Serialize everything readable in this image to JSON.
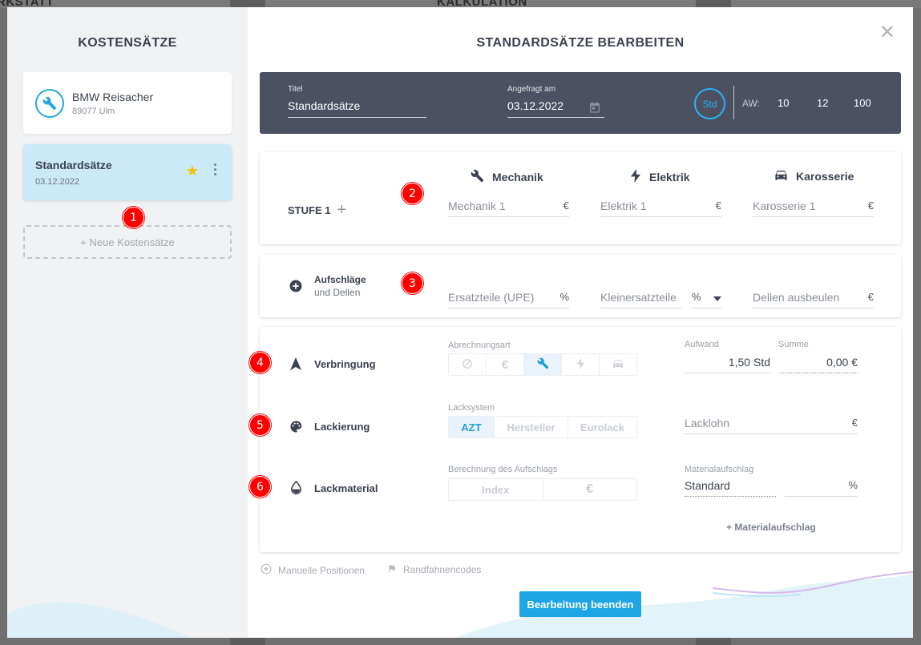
{
  "background": {
    "left_text": "RKSTATT",
    "center_text": "KALKULATION"
  },
  "sidebar": {
    "title": "KOSTENSÄTZE",
    "cards": [
      {
        "name": "BMW Reisacher",
        "sub": "89077 Ulm",
        "icon": "wrench-icon"
      },
      {
        "name": "Standardsätze",
        "sub": "03.12.2022",
        "favorite": true
      }
    ],
    "new_button": "+ Neue Kostensätze"
  },
  "main": {
    "title": "STANDARDSÄTZE BEARBEITEN",
    "header": {
      "titel_label": "Titel",
      "titel_value": "Standardsätze",
      "date_label": "Angefragt am",
      "date_value": "03.12.2022",
      "std_label": "Std",
      "aw_label": "AW:",
      "aw_values": [
        "10",
        "12",
        "100"
      ]
    },
    "rates": {
      "stufe_label": "STUFE 1",
      "columns": [
        {
          "title": "Mechanik",
          "icon": "wrench-icon",
          "placeholder": "Mechanik 1",
          "unit": "€"
        },
        {
          "title": "Elektrik",
          "icon": "bolt-icon",
          "placeholder": "Elektrik 1",
          "unit": "€"
        },
        {
          "title": "Karosserie",
          "icon": "car-icon",
          "placeholder": "Karosserie 1",
          "unit": "€"
        }
      ]
    },
    "surcharges": {
      "title": "Aufschläge",
      "subtitle": "und Dellen",
      "ersatzteile": {
        "placeholder": "Ersatzteile (UPE)",
        "unit": "%"
      },
      "kleinersatzteile": {
        "placeholder": "Kleinersatzteile",
        "unit": "%"
      },
      "dellen": {
        "placeholder": "Dellen ausbeulen",
        "unit": "€"
      }
    },
    "verbringung": {
      "label": "Verbringung",
      "abrechnungsart_label": "Abrechnungsart",
      "aufwand_label": "Aufwand",
      "aufwand_value": "1,50 Std",
      "summe_label": "Summe",
      "summe_value": "0,00 €"
    },
    "lackierung": {
      "label": "Lackierung",
      "lacksystem_label": "Lacksystem",
      "options": [
        "AZT",
        "Hersteller",
        "Eurolack"
      ],
      "lacklohn_placeholder": "Lacklohn",
      "lacklohn_unit": "€"
    },
    "lackmaterial": {
      "label": "Lackmaterial",
      "berechnung_label": "Berechnung des Aufschlags",
      "options": [
        "Index",
        "€"
      ],
      "materialaufschlag_label": "Materialaufschlag",
      "materialaufschlag_value": "Standard",
      "percent_unit": "%",
      "add_link": "+ Materialaufschlag"
    },
    "footer": {
      "manual": "Manuelle Positionen",
      "codes": "Randfahnencodes",
      "done_button": "Bearbeitung beenden"
    }
  },
  "annotations": [
    "1",
    "2",
    "3",
    "4",
    "5",
    "6"
  ],
  "colors": {
    "accent": "#1ea5e6",
    "header_bg": "#4b5160",
    "badge": "#ff0000",
    "selected_card": "#cbe9f7",
    "star": "#f5c400"
  }
}
